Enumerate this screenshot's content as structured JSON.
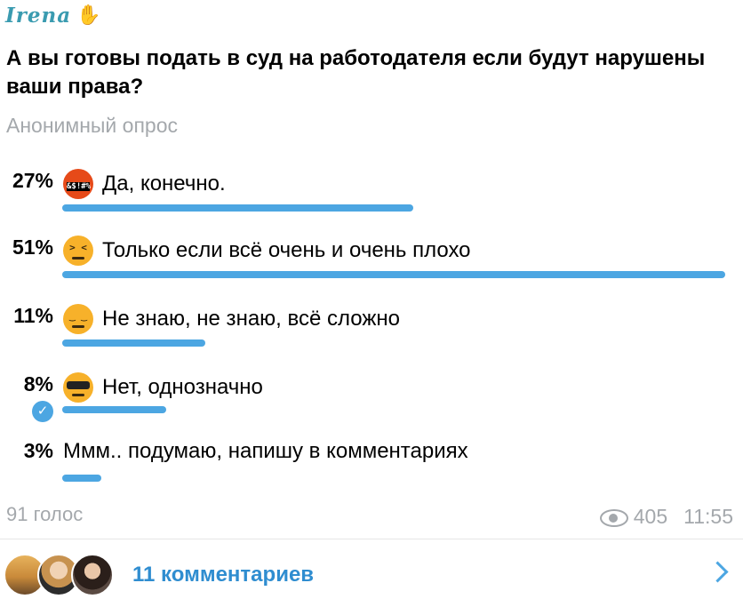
{
  "post": {
    "author": "Irena",
    "author_icon": "waving-hand-icon"
  },
  "poll": {
    "question": "А вы готовы подать в суд на работодателя если будут нарушены ваши права?",
    "type": "Анонимный опрос",
    "options": [
      {
        "percent": "27%",
        "fraction": 0.27,
        "emoji": "swearing-face-icon",
        "text": "Да, конечно.",
        "chosen": false
      },
      {
        "percent": "51%",
        "fraction": 0.51,
        "emoji": "persevering-face-icon",
        "text": "Только если всё очень и очень плохо",
        "chosen": false
      },
      {
        "percent": "11%",
        "fraction": 0.11,
        "emoji": "pensive-face-icon",
        "text": "Не знаю, не знаю, всё сложно",
        "chosen": false
      },
      {
        "percent": "8%",
        "fraction": 0.08,
        "emoji": "sunglasses-face-icon",
        "text": "Нет, однозначно",
        "chosen": true
      },
      {
        "percent": "3%",
        "fraction": 0.03,
        "emoji": "",
        "text": "Ммм.. подумаю, напишу в комментариях",
        "chosen": false
      }
    ],
    "votes": "91 голос",
    "accent_color": "#4ca6e2"
  },
  "footer": {
    "views": "405",
    "time": "11:55",
    "comments_label": "11 комментариев"
  }
}
